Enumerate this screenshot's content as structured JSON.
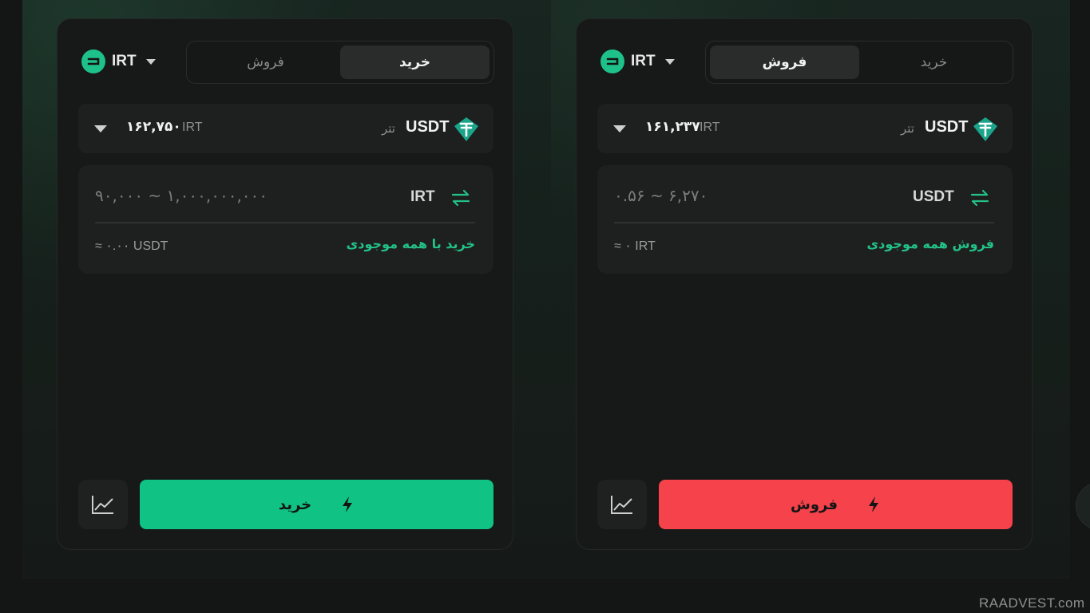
{
  "buy_panel": {
    "currency_code": "IRT",
    "tabs": [
      {
        "label": "خرید",
        "active": true
      },
      {
        "label": "فروش",
        "active": false
      }
    ],
    "price": "۱۶۲,۷۵۰",
    "price_unit": "IRT",
    "asset_fa": "تتر",
    "asset_code": "USDT",
    "input_range": "۹۰,۰۰۰ ~ ۱,۰۰۰,۰۰۰,۰۰۰",
    "input_unit": "IRT",
    "approx": "≈ ۰.۰۰ USDT",
    "all_balance": "خرید با همه موجودی",
    "action_label": "خرید",
    "action_color": "#10c384"
  },
  "sell_panel": {
    "currency_code": "IRT",
    "tabs": [
      {
        "label": "خرید",
        "active": false
      },
      {
        "label": "فروش",
        "active": true
      }
    ],
    "price": "۱۶۱,۲۳۷",
    "price_unit": "IRT",
    "asset_fa": "تتر",
    "asset_code": "USDT",
    "input_range": "۰.۵۶ ~ ۶,۲۷۰",
    "input_unit": "USDT",
    "approx": "≈ ۰ IRT",
    "all_balance": "فروش همه موجودی",
    "action_label": "فروش",
    "action_color": "#f5424b"
  },
  "icons": {
    "currency_logo": "irt-logo-icon",
    "dropdown": "caret-down-icon",
    "asset": "tether-icon",
    "swap": "swap-arrows-icon",
    "chart": "chart-line-icon",
    "action": "lightning-bolt-icon"
  },
  "accent_green": "#23c287",
  "watermark": "RAADVEST.com"
}
